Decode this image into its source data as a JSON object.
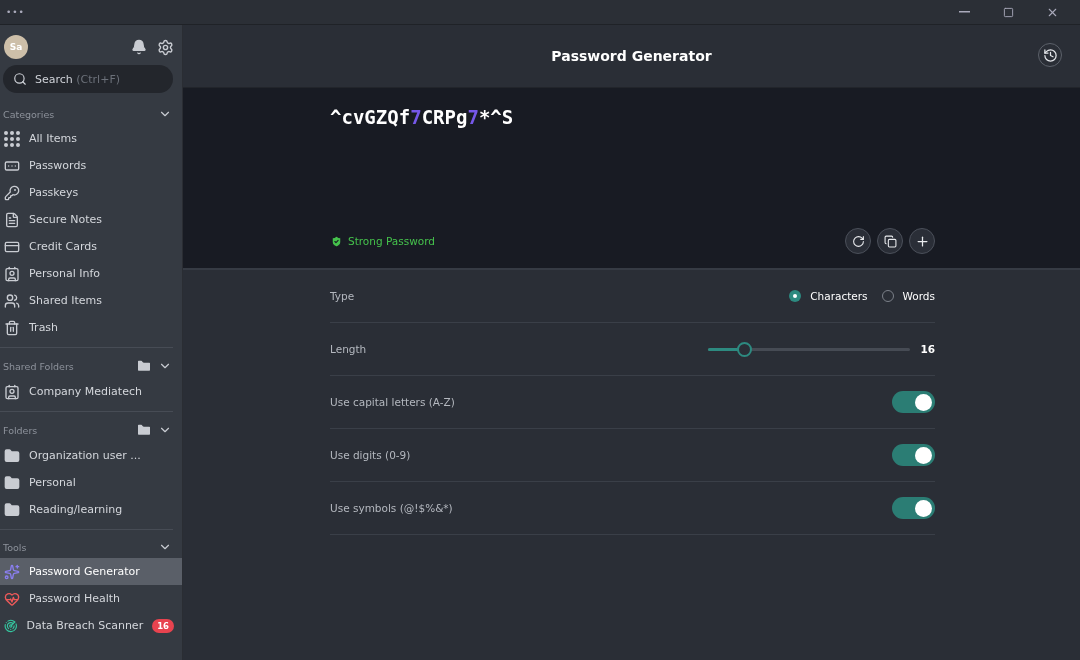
{
  "titlebar": {
    "menu": "•••"
  },
  "sidebar": {
    "avatar": "Sa",
    "search": {
      "placeholder": "Search",
      "hint": "(Ctrl+F)"
    },
    "sections": [
      {
        "title": "Categories",
        "add": false,
        "items": [
          {
            "label": "All Items",
            "kind": "grid",
            "selected": false
          },
          {
            "label": "Passwords",
            "kind": "password",
            "selected": false
          },
          {
            "label": "Passkeys",
            "kind": "passkey",
            "selected": false
          },
          {
            "label": "Secure Notes",
            "kind": "note",
            "selected": false
          },
          {
            "label": "Credit Cards",
            "kind": "card",
            "selected": false
          },
          {
            "label": "Personal Info",
            "kind": "contact",
            "selected": false
          },
          {
            "label": "Shared Items",
            "kind": "users",
            "selected": false
          },
          {
            "label": "Trash",
            "kind": "trash",
            "selected": false
          }
        ]
      },
      {
        "title": "Shared Folders",
        "add": true,
        "items": [
          {
            "label": "Company Mediatech",
            "kind": "shared",
            "selected": false
          }
        ]
      },
      {
        "title": "Folders",
        "add": true,
        "items": [
          {
            "label": "Organization user ...",
            "kind": "folder",
            "selected": false
          },
          {
            "label": "Personal",
            "kind": "folder",
            "selected": false
          },
          {
            "label": "Reading/learning",
            "kind": "folder",
            "selected": false
          }
        ]
      },
      {
        "title": "Tools",
        "add": false,
        "items": [
          {
            "label": "Password Generator",
            "kind": "generator",
            "selected": true
          },
          {
            "label": "Password Health",
            "kind": "health",
            "selected": false
          },
          {
            "label": "Data Breach Scanner",
            "kind": "scanner",
            "selected": false,
            "badge": "16"
          }
        ]
      }
    ]
  },
  "header": {
    "title": "Password Generator"
  },
  "generator": {
    "password": "^cvGZQf7CRPg7*^S",
    "strength": "Strong Password"
  },
  "settings": [
    {
      "kind": "radio",
      "label": "Type",
      "options": [
        {
          "label": "Characters",
          "selected": true
        },
        {
          "label": "Words",
          "selected": false
        }
      ]
    },
    {
      "kind": "slider",
      "label": "Length",
      "level": 0.18,
      "reading": "16"
    },
    {
      "kind": "toggle",
      "label": "Use capital letters (A-Z)",
      "on": true
    },
    {
      "kind": "toggle",
      "label": "Use digits (0-9)",
      "on": true
    },
    {
      "kind": "toggle",
      "label": "Use symbols (@!$%&*)",
      "on": true
    }
  ]
}
